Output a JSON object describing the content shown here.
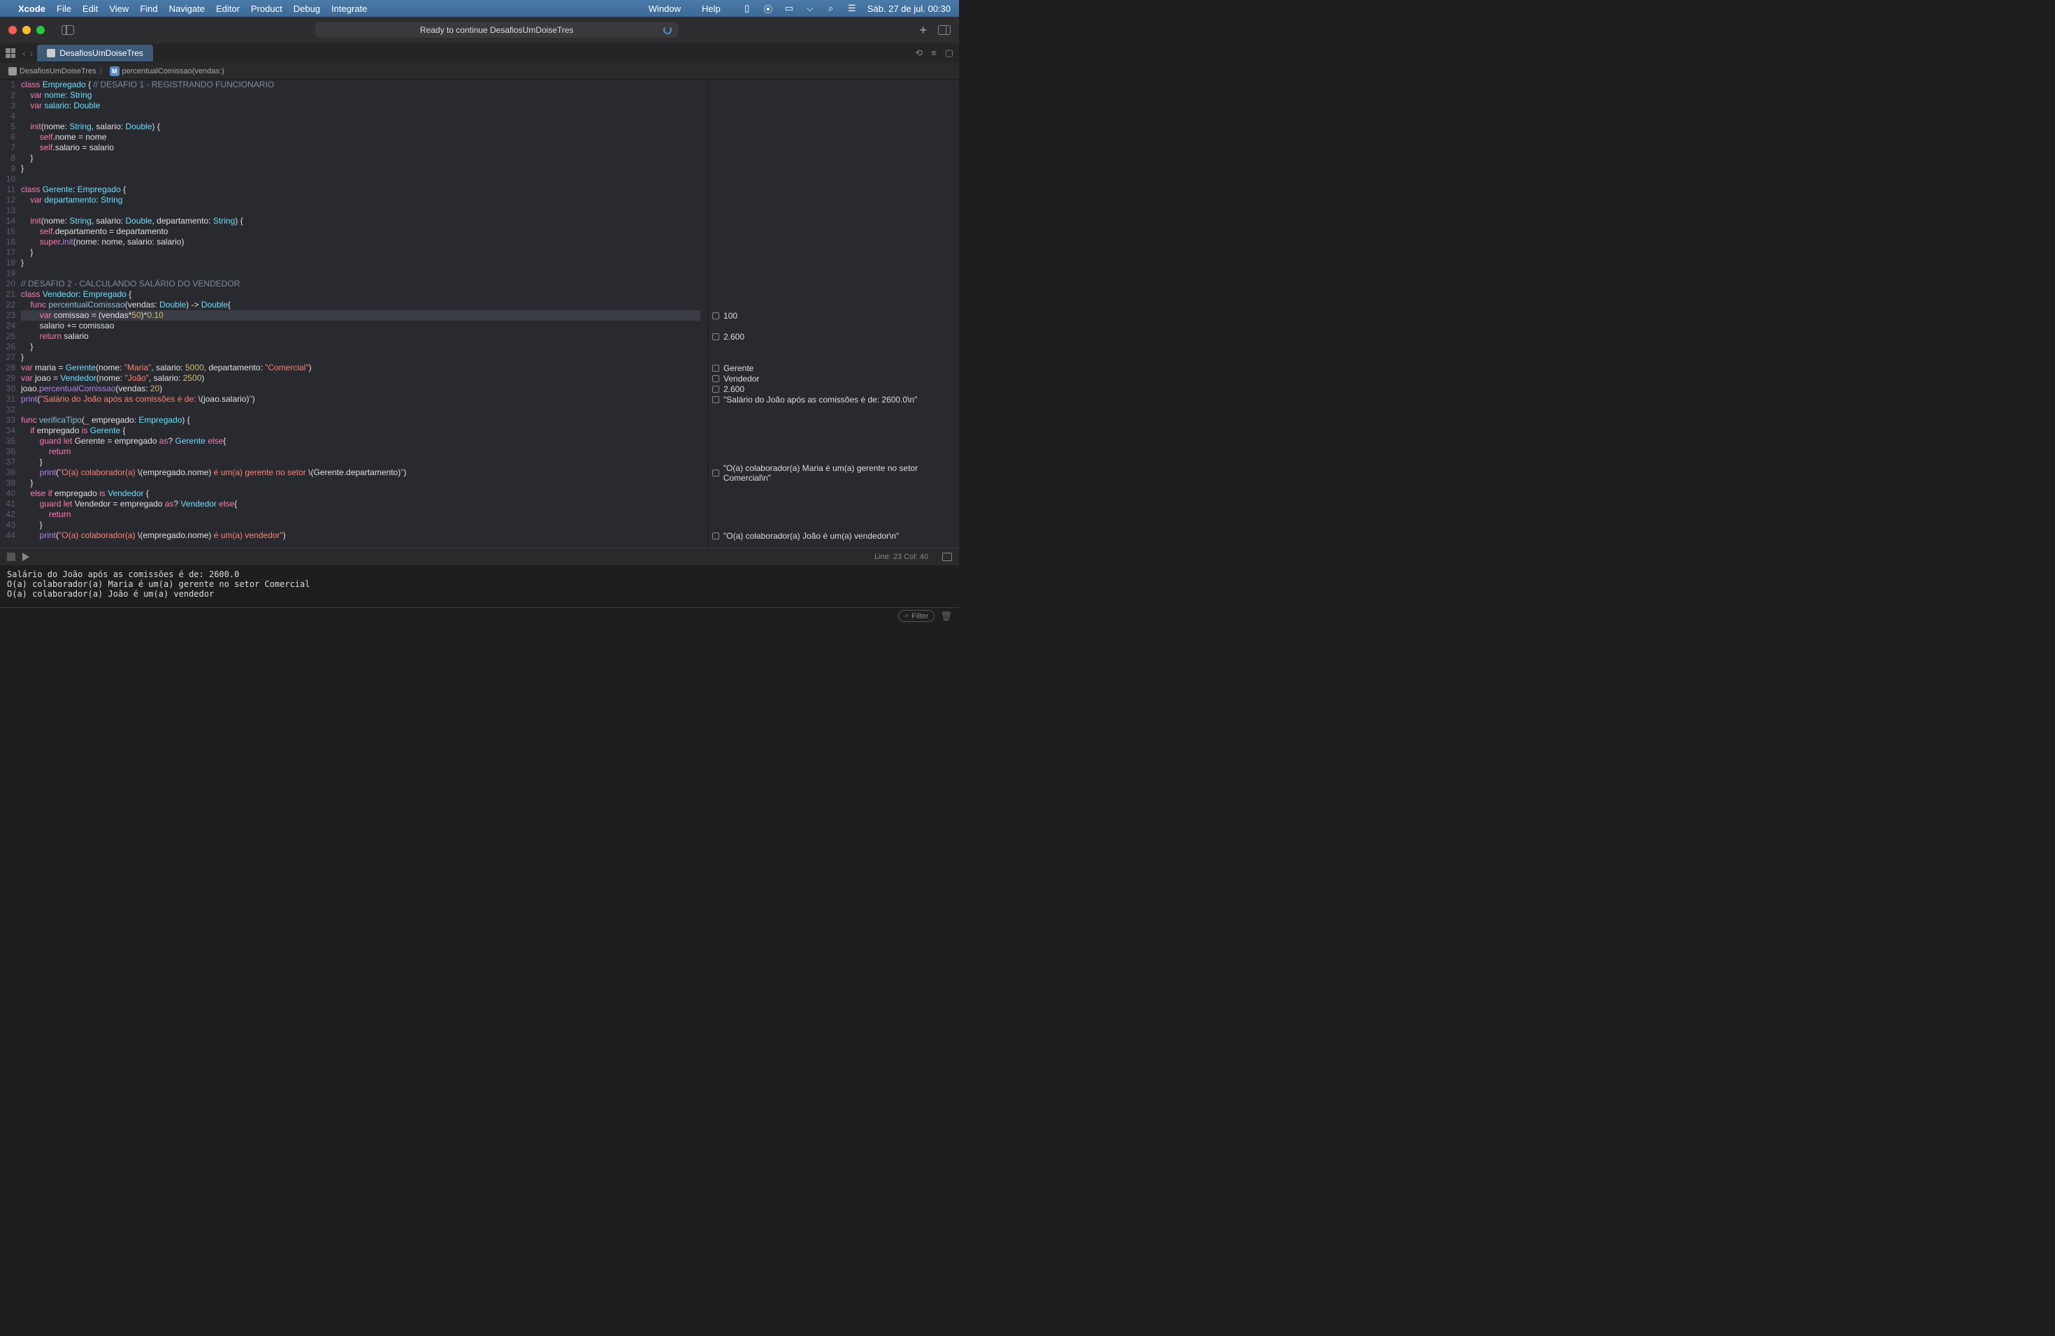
{
  "menubar": {
    "app": "Xcode",
    "items": [
      "File",
      "Edit",
      "View",
      "Find",
      "Navigate",
      "Editor",
      "Product",
      "Debug",
      "Integrate"
    ],
    "right_items": [
      "Window",
      "Help"
    ],
    "datetime": "Sáb. 27 de jul.  00:30"
  },
  "titlebar": {
    "status": "Ready to continue DesafiosUmDoiseTres"
  },
  "tabs": {
    "active": "DesafiosUmDoiseTres"
  },
  "breadcrumb": {
    "project": "DesafiosUmDoiseTres",
    "symbol": "percentualComissao(vendas:)"
  },
  "editor": {
    "highlighted_line": 23,
    "lines": [
      {
        "n": 1,
        "html": "<span class='kw'>class</span> <span class='type'>Empregado</span> <span class='plain'>{</span> <span class='cmt'>// DESAFIO 1 - REGISTRANDO FUNCIONARIO</span>"
      },
      {
        "n": 2,
        "html": "    <span class='kw'>var</span> <span class='prop'>nome</span><span class='plain'>:</span> <span class='type'>String</span>"
      },
      {
        "n": 3,
        "html": "    <span class='kw'>var</span> <span class='prop'>salario</span><span class='plain'>:</span> <span class='type'>Double</span>"
      },
      {
        "n": 4,
        "html": ""
      },
      {
        "n": 5,
        "html": "    <span class='kw'>init</span><span class='plain'>(nome:</span> <span class='type'>String</span><span class='plain'>, salario:</span> <span class='type'>Double</span><span class='plain'>) {</span>"
      },
      {
        "n": 6,
        "html": "        <span class='self'>self</span><span class='plain'>.nome = nome</span>"
      },
      {
        "n": 7,
        "html": "        <span class='self'>self</span><span class='plain'>.salario = salario</span>"
      },
      {
        "n": 8,
        "html": "    <span class='plain'>}</span>"
      },
      {
        "n": 9,
        "html": "<span class='plain'>}</span>"
      },
      {
        "n": 10,
        "html": ""
      },
      {
        "n": 11,
        "html": "<span class='kw'>class</span> <span class='type'>Gerente</span><span class='plain'>:</span> <span class='type'>Empregado</span> <span class='plain'>{</span>"
      },
      {
        "n": 12,
        "html": "    <span class='kw'>var</span> <span class='prop'>departamento</span><span class='plain'>:</span> <span class='type'>String</span>"
      },
      {
        "n": 13,
        "html": ""
      },
      {
        "n": 14,
        "html": "    <span class='kw'>init</span><span class='plain'>(nome:</span> <span class='type'>String</span><span class='plain'>, salario:</span> <span class='type'>Double</span><span class='plain'>, departamento:</span> <span class='type'>String</span><span class='plain'>) {</span>"
      },
      {
        "n": 15,
        "html": "        <span class='self'>self</span><span class='plain'>.departamento = departamento</span>"
      },
      {
        "n": 16,
        "html": "        <span class='kw'>super</span><span class='plain'>.</span><span class='call'>init</span><span class='plain'>(nome: nome, salario: salario)</span>"
      },
      {
        "n": 17,
        "html": "    <span class='plain'>}</span>"
      },
      {
        "n": 18,
        "html": "<span class='plain'>}</span>"
      },
      {
        "n": 19,
        "html": ""
      },
      {
        "n": 20,
        "html": "<span class='cmt'>// DESAFIO 2 - CALCULANDO SALÁRIO DO VENDEDOR</span>"
      },
      {
        "n": 21,
        "html": "<span class='kw'>class</span> <span class='type'>Vendedor</span><span class='plain'>:</span> <span class='type'>Empregado</span> <span class='plain'>{</span>"
      },
      {
        "n": 22,
        "html": "    <span class='kw'>func</span> <span class='fn'>percentualComissao</span><span class='plain'>(vendas:</span> <span class='type'>Double</span><span class='plain'>) -&gt;</span> <span class='type'>Double</span><span class='plain'>{</span>"
      },
      {
        "n": 23,
        "html": "        <span class='kw'>var</span> <span class='plain'>comissao = (vendas*</span><span class='num'>50</span><span class='plain'>)*</span><span class='num'>0.10</span>"
      },
      {
        "n": 24,
        "html": "        <span class='plain'>salario += comissao</span>"
      },
      {
        "n": 25,
        "html": "        <span class='kw'>return</span> <span class='plain'>salario</span>"
      },
      {
        "n": 26,
        "html": "    <span class='plain'>}</span>"
      },
      {
        "n": 27,
        "html": "<span class='plain'>}</span>"
      },
      {
        "n": 28,
        "html": "<span class='kw'>var</span> <span class='plain'>maria = </span><span class='type'>Gerente</span><span class='plain'>(nome: </span><span class='str'>\"Maria\"</span><span class='plain'>, salario: </span><span class='num'>5000</span><span class='plain'>, departamento: </span><span class='str'>\"Comercial\"</span><span class='plain'>)</span>"
      },
      {
        "n": 29,
        "html": "<span class='kw'>var</span> <span class='plain'>joao = </span><span class='type'>Vendedor</span><span class='plain'>(nome: </span><span class='str'>\"João\"</span><span class='plain'>, salario: </span><span class='num'>2500</span><span class='plain'>)</span>"
      },
      {
        "n": 30,
        "html": "<span class='plain'>joao.</span><span class='call'>percentualComissao</span><span class='plain'>(vendas: </span><span class='num'>20</span><span class='plain'>)</span>"
      },
      {
        "n": 31,
        "html": "<span class='call'>print</span><span class='plain'>(</span><span class='str'>\"Salário do João após as comissões é de: </span><span class='plain'>\\(</span><span class='plain'>joao.salario</span><span class='plain'>)</span><span class='str'>\"</span><span class='plain'>)</span>"
      },
      {
        "n": 32,
        "html": ""
      },
      {
        "n": 33,
        "html": "<span class='kw'>func</span> <span class='fn'>verificaTipo</span><span class='plain'>(</span><span class='kw'>_</span> <span class='plain'>empregado:</span> <span class='type'>Empregado</span><span class='plain'>) {</span>"
      },
      {
        "n": 34,
        "html": "    <span class='kw'>if</span> <span class='plain'>empregado </span><span class='kw'>is</span> <span class='type'>Gerente</span> <span class='plain'>{</span>"
      },
      {
        "n": 35,
        "html": "        <span class='kw'>guard let</span> <span class='plain'>Gerente = empregado </span><span class='kw'>as</span><span class='plain'>?</span> <span class='type'>Gerente</span> <span class='kw'>else</span><span class='plain'>{</span>"
      },
      {
        "n": 36,
        "html": "            <span class='kw'>return</span>"
      },
      {
        "n": 37,
        "html": "        <span class='plain'>}</span>"
      },
      {
        "n": 38,
        "html": "        <span class='call'>print</span><span class='plain'>(</span><span class='str'>\"O(a) colaborador(a) </span><span class='plain'>\\(empregado.nome)</span><span class='str'> é um(a) gerente no setor </span><span class='plain'>\\(Gerente.departamento)</span><span class='str'>\"</span><span class='plain'>)</span>"
      },
      {
        "n": 39,
        "html": "    <span class='plain'>}</span>"
      },
      {
        "n": 40,
        "html": "    <span class='kw'>else if</span> <span class='plain'>empregado </span><span class='kw'>is</span> <span class='type'>Vendedor</span> <span class='plain'>{</span>"
      },
      {
        "n": 41,
        "html": "        <span class='kw'>guard let</span> <span class='plain'>Vendedor = empregado </span><span class='kw'>as</span><span class='plain'>?</span> <span class='type'>Vendedor</span> <span class='kw'>else</span><span class='plain'>{</span>"
      },
      {
        "n": 42,
        "html": "            <span class='kw'>return</span>"
      },
      {
        "n": 43,
        "html": "        <span class='plain'>}</span>"
      },
      {
        "n": 44,
        "html": "        <span class='call'>print</span><span class='plain'>(</span><span class='str'>\"O(a) colaborador(a) </span><span class='plain'>\\(empregado.nome)</span><span class='str'> é um(a) vendedor\"</span><span class='plain'>)</span>"
      }
    ]
  },
  "results": [
    {
      "line": 23,
      "text": "100"
    },
    {
      "line": 25,
      "text": "2.600"
    },
    {
      "line": 28,
      "text": "Gerente"
    },
    {
      "line": 29,
      "text": "Vendedor"
    },
    {
      "line": 30,
      "text": "2.600"
    },
    {
      "line": 31,
      "text": "\"Salário do João após as comissões é de: 2600.0\\n\""
    },
    {
      "line": 38,
      "text": "\"O(a) colaborador(a) Maria é um(a) gerente no setor Comercial\\n\""
    },
    {
      "line": 44,
      "text": "\"O(a) colaborador(a) João é um(a) vendedor\\n\""
    }
  ],
  "console": {
    "status": "Line: 23  Col: 40",
    "output": "Salário do João após as comissões é de: 2600.0\nO(a) colaborador(a) Maria é um(a) gerente no setor Comercial\nO(a) colaborador(a) João é um(a) vendedor",
    "filter_placeholder": "Filter"
  }
}
